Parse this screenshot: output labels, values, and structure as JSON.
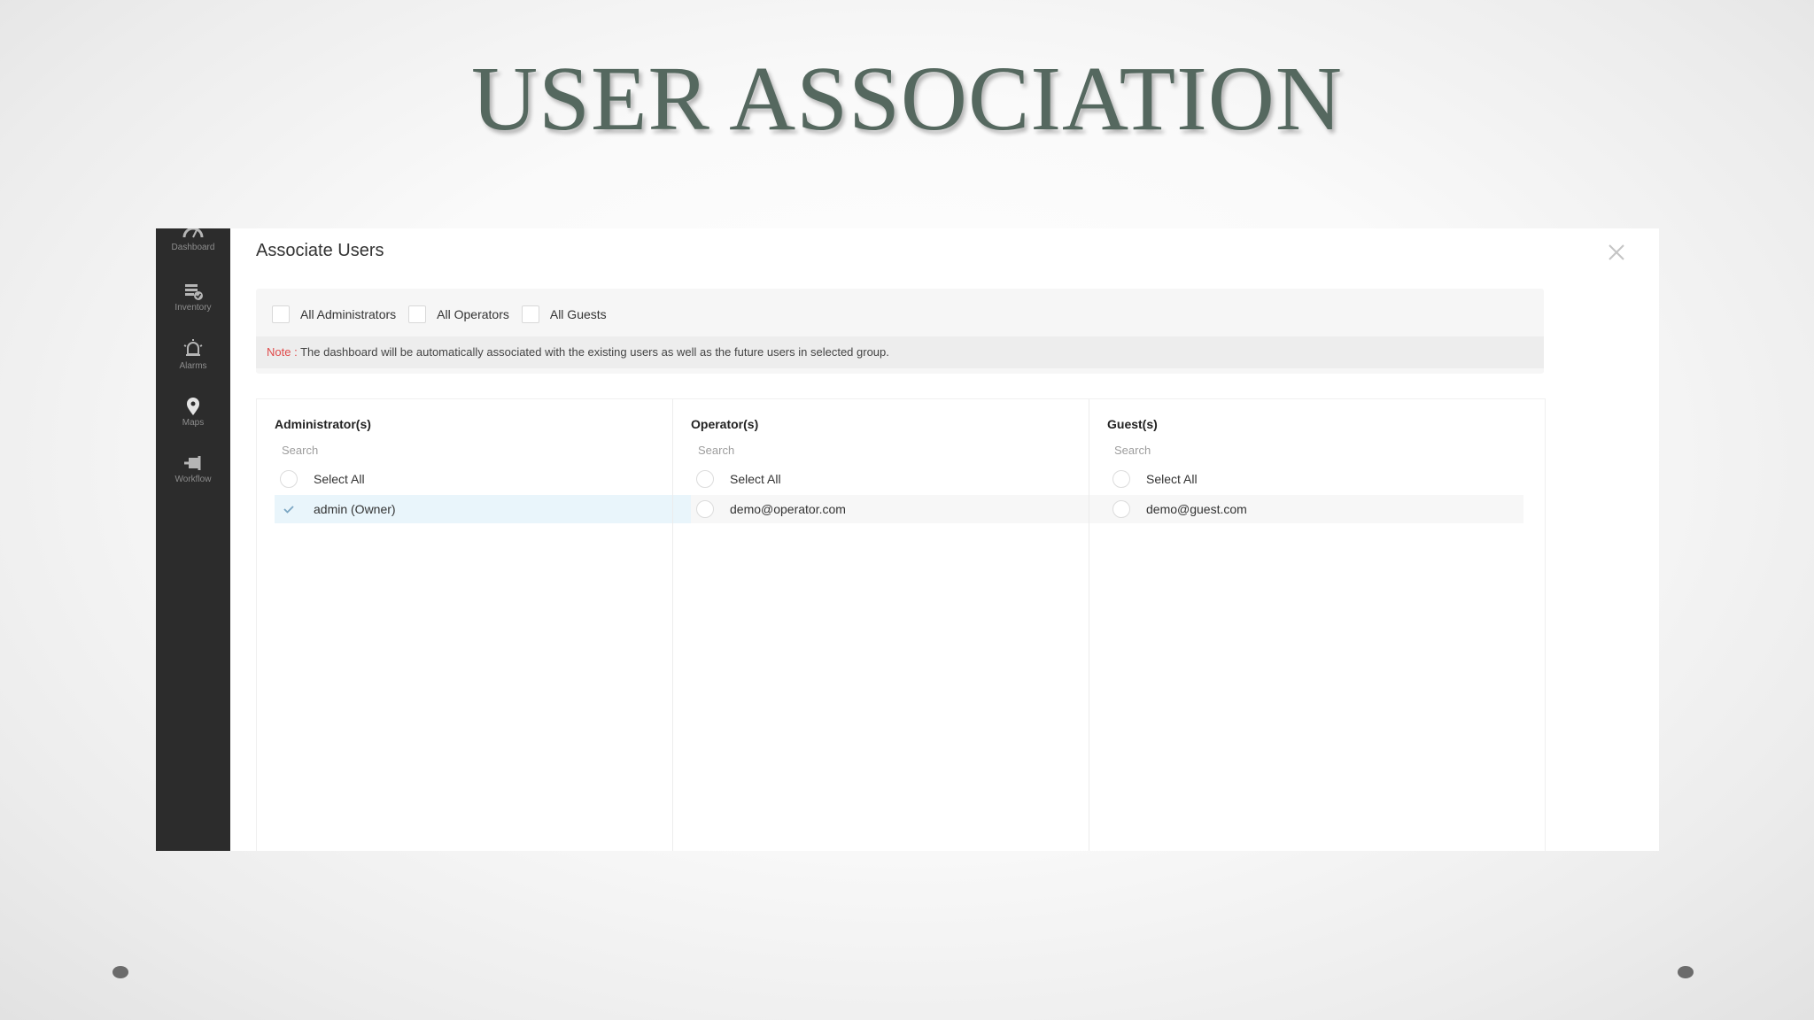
{
  "slide": {
    "title": "USER ASSOCIATION"
  },
  "nav": {
    "items": [
      {
        "label": "Dashboard",
        "icon": "dashboard-gauge-icon"
      },
      {
        "label": "Inventory",
        "icon": "inventory-icon"
      },
      {
        "label": "Alarms",
        "icon": "alarm-bell-icon"
      },
      {
        "label": "Maps",
        "icon": "map-pin-icon"
      },
      {
        "label": "Workflow",
        "icon": "workflow-icon"
      }
    ]
  },
  "modal": {
    "title": "Associate Users",
    "close_icon": "close-icon",
    "groups": {
      "all_administrators": "All Administrators",
      "all_operators": "All Operators",
      "all_guests": "All Guests"
    },
    "note": {
      "label": "Note :",
      "text": "The dashboard will be automatically associated with the existing users as well as the future users in selected group."
    },
    "columns": {
      "administrators": {
        "header": "Administrator(s)",
        "search_placeholder": "Search",
        "select_all": "Select All",
        "items": [
          {
            "label": "admin (Owner)",
            "selected": true
          }
        ]
      },
      "operators": {
        "header": "Operator(s)",
        "search_placeholder": "Search",
        "select_all": "Select All",
        "items": [
          {
            "label": "demo@operator.com",
            "selected": false
          }
        ]
      },
      "guests": {
        "header": "Guest(s)",
        "search_placeholder": "Search",
        "select_all": "Select All",
        "items": [
          {
            "label": "demo@guest.com",
            "selected": false
          }
        ]
      }
    }
  },
  "colors": {
    "title": "#55685f",
    "nav_bg": "#2c2c2c",
    "selected_row": "#e9f5fb",
    "note_label": "#e04b4b"
  }
}
